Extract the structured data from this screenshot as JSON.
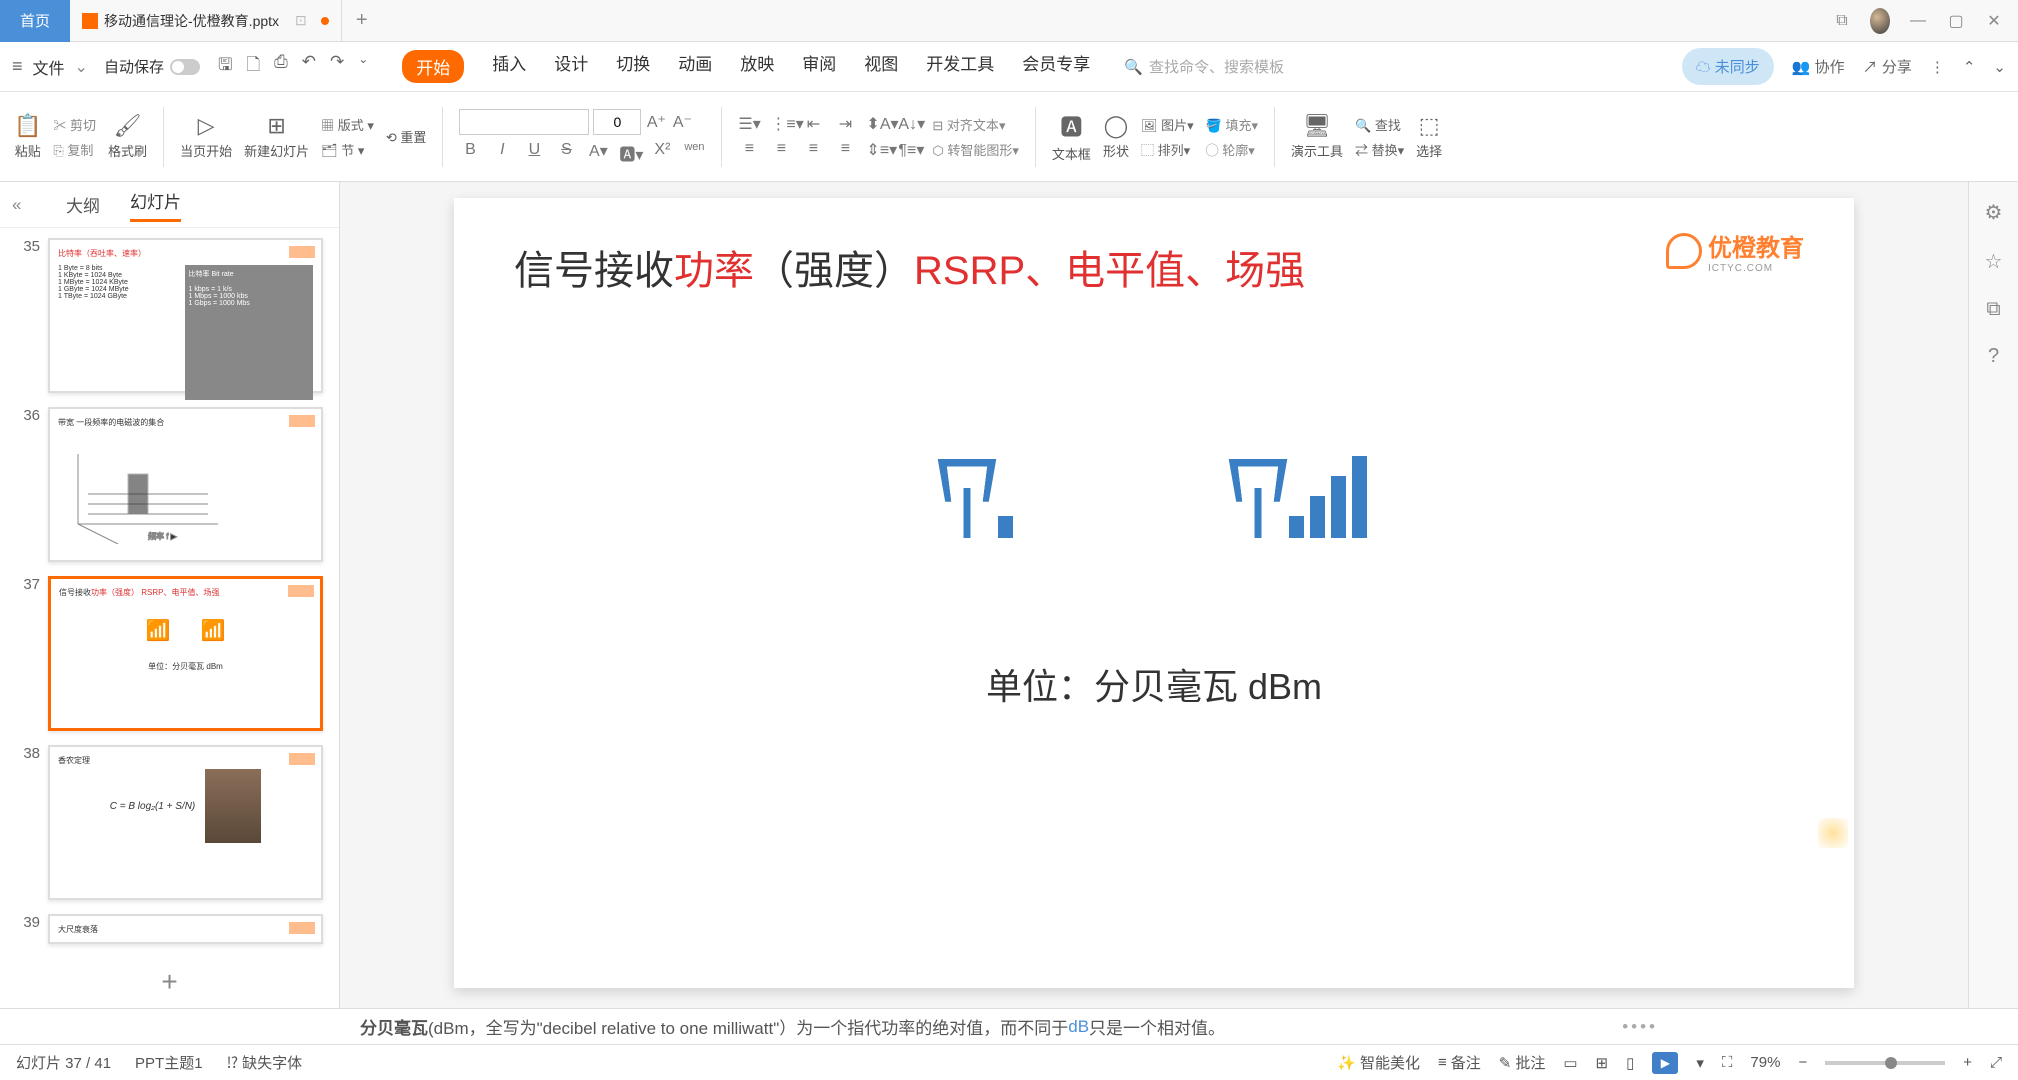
{
  "titlebar": {
    "home": "首页",
    "filename": "移动通信理论-优橙教育.pptx",
    "add": "+"
  },
  "menubar": {
    "file": "文件",
    "autosave": "自动保存",
    "tabs": {
      "start": "开始",
      "insert": "插入",
      "design": "设计",
      "transition": "切换",
      "animation": "动画",
      "slideshow": "放映",
      "review": "审阅",
      "view": "视图",
      "devtools": "开发工具",
      "member": "会员专享"
    },
    "search_placeholder": "查找命令、搜索模板",
    "sync": "未同步",
    "collab": "协作",
    "share": "分享"
  },
  "ribbon": {
    "paste": "粘贴",
    "cut": "剪切",
    "copy": "复制",
    "format_painter": "格式刷",
    "start_current": "当页开始",
    "new_slide": "新建幻灯片",
    "layout": "版式",
    "section": "节",
    "reset": "重置",
    "font_size": "0",
    "align_text": "对齐文本",
    "smart_shape": "转智能图形",
    "textbox": "文本框",
    "shape": "形状",
    "picture": "图片",
    "fill": "填充",
    "arrange": "排列",
    "outline": "轮廓",
    "present_tools": "演示工具",
    "find": "查找",
    "replace": "替换",
    "select": "选择",
    "icons": {
      "bold": "B",
      "italic": "I",
      "underline": "U",
      "strike": "S",
      "wen": "wen"
    }
  },
  "sidePanel": {
    "outline": "大纲",
    "slides": "幻灯片",
    "thumbs": {
      "35": {
        "title": "比特率（吞吐率、速率）",
        "box_title": "比特率 Bit rate"
      },
      "36": {
        "title": "带宽   一段频率的电磁波的集合"
      },
      "37": {
        "title_a": "信号接收",
        "title_b": "功率（强度）",
        "title_c": "RSRP、电平值、场强",
        "unit": "单位：分贝毫瓦 dBm"
      },
      "38": {
        "title": "香农定理",
        "eq": "C = B log₂(1 + S/N)"
      },
      "39": {
        "title": "大尺度衰落"
      }
    }
  },
  "slide": {
    "logo_text": "优橙教育",
    "logo_sub": "ICTYC.COM",
    "title_a": "信号接收",
    "title_b": "功率",
    "title_c": "（强度）",
    "title_d": "RSRP、电平值、场强",
    "unit": "单位：分贝毫瓦 dBm"
  },
  "notes": {
    "bold": "分贝毫瓦",
    "text1": "(dBm，全写为\"decibel relative to one milliwatt\"）为一个指代功率的绝对值，而不同于",
    "link": "dB",
    "text2": "只是一个相对值。"
  },
  "statusbar": {
    "slide_count": "幻灯片 37 / 41",
    "theme": "PPT主题1",
    "missing_font": "缺失字体",
    "beautify": "智能美化",
    "notes": "备注",
    "comments": "批注",
    "zoom": "79%"
  }
}
